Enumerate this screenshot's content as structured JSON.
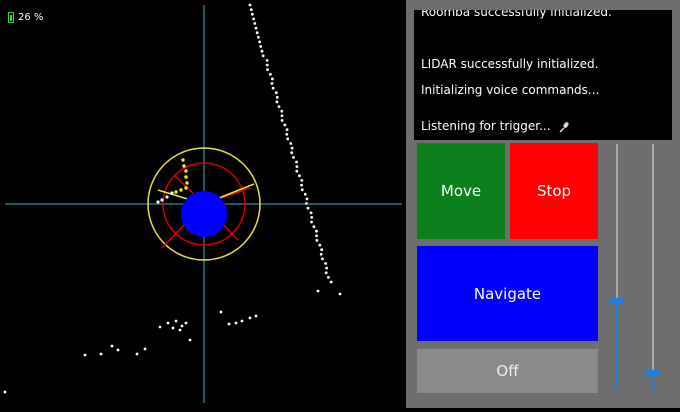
{
  "status": {
    "battery": "26 %",
    "battery_color": "#2fd34a"
  },
  "log": {
    "lines": [
      "Roomba successfully initialized.",
      "LIDAR successfully initialized.",
      "Initializing voice commands...",
      "Listening for trigger..."
    ],
    "mic_icon": "microphone-icon"
  },
  "controls": {
    "move": "Move",
    "stop": "Stop",
    "navigate": "Navigate",
    "off": "Off"
  },
  "sliders": [
    {
      "value": 0.37
    },
    {
      "value": 0.08
    }
  ],
  "colors": {
    "move": "#0a7f1c",
    "stop": "#ff0000",
    "navigate": "#0000ff",
    "off": "#8a8a8a",
    "robot": "#0000ff",
    "inner_ring": "#d60000",
    "outer_ring": "#e5e23a",
    "crosshair": "#2fb7b7",
    "slider_accent": "#1f7fe0"
  }
}
